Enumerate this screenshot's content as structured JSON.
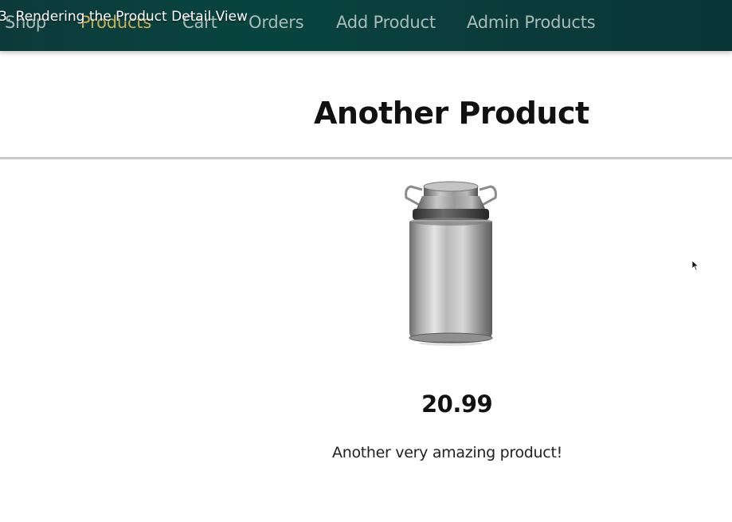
{
  "video_overlay": {
    "title": "3. Rendering the Product Detail View"
  },
  "nav": {
    "items": [
      {
        "label": "Shop",
        "active": false
      },
      {
        "label": "Products",
        "active": true
      },
      {
        "label": "Cart",
        "active": false
      },
      {
        "label": "Orders",
        "active": false
      },
      {
        "label": "Add Product",
        "active": false
      },
      {
        "label": "Admin Products",
        "active": false
      }
    ]
  },
  "product": {
    "title": "Another Product",
    "price": "20.99",
    "description": "Another very amazing product!",
    "image_icon": "milk-can-image"
  },
  "colors": {
    "header_bg": "#0a3d3b",
    "nav_text": "#a9bdb9",
    "nav_active": "#c6b15a",
    "divider": "#c8c8c8"
  }
}
